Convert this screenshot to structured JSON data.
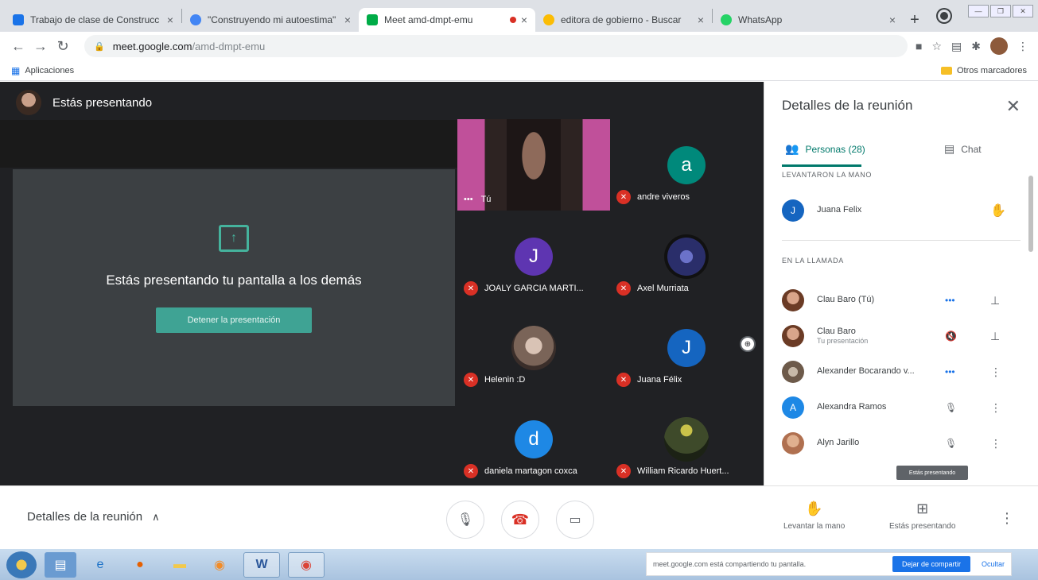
{
  "browser": {
    "tabs": [
      {
        "title": "Trabajo de clase de Construcc",
        "color": "#1a73e8"
      },
      {
        "title": "\"Construyendo mi autoestima\"",
        "color": "#1a73e8"
      },
      {
        "title": "Meet amd-dmpt-emu",
        "color": "#00ac47"
      },
      {
        "title": "editora de gobierno - Buscar",
        "color": "#fbbc04"
      },
      {
        "title": "WhatsApp",
        "color": "#25d366"
      }
    ],
    "url_host": "meet.google.com",
    "url_path": "/amd-dmpt-emu",
    "bookmarks_apps": "Aplicaciones",
    "bookmarks_other": "Otros marcadores"
  },
  "meet": {
    "presenting_header": "Estás presentando",
    "stage_text": "Estás presentando tu pantalla a los demás",
    "stop_button": "Detener la presentación",
    "tiles": [
      {
        "name": "Tú",
        "type": "video"
      },
      {
        "name": "andre viveros",
        "initial": "a",
        "color": "#00897b"
      },
      {
        "name": "JOALY GARCIA MARTI...",
        "initial": "J",
        "color": "#5e35b1"
      },
      {
        "name": "Axel Murriata",
        "type": "photo",
        "color": "#2a2e6a"
      },
      {
        "name": "Helenin :D",
        "type": "photo",
        "color": "#7a6458"
      },
      {
        "name": "Juana Félix",
        "initial": "J",
        "color": "#1565c0"
      },
      {
        "name": "daniela martagon coxca",
        "initial": "d",
        "color": "#1e88e5"
      },
      {
        "name": "William Ricardo Huert...",
        "type": "photo",
        "color": "#3e4a2a"
      }
    ]
  },
  "panel": {
    "title": "Detalles de la reunión",
    "tab_people": "Personas (28)",
    "tab_chat": "Chat",
    "raised_label": "LEVANTARON LA MANO",
    "raised": [
      {
        "name": "Juana Felix",
        "initial": "J",
        "color": "#1565c0"
      }
    ],
    "incall_label": "EN LA LLAMADA",
    "participants": [
      {
        "name": "Clau Baro (Tú)",
        "sub": "",
        "color": "#8d5a3b",
        "initial": ""
      },
      {
        "name": "Clau Baro",
        "sub": "Tu presentación",
        "color": "#8d5a3b",
        "initial": ""
      },
      {
        "name": "Alexander Bocarando v...",
        "sub": "",
        "color": "#6d5a4a",
        "initial": ""
      },
      {
        "name": "Alexandra Ramos",
        "sub": "",
        "color": "#1e88e5",
        "initial": "A"
      },
      {
        "name": "Alyn Jarillo",
        "sub": "",
        "color": "#b07050",
        "initial": ""
      }
    ],
    "tooltip": "Estás presentando"
  },
  "bottom": {
    "meeting_details": "Detalles de la reunión",
    "raise_hand": "Levantar la mano",
    "presenting": "Estás presentando"
  },
  "taskbar": {
    "share_msg": "meet.google.com está compartiendo tu pantalla.",
    "stop_share": "Dejar de compartir",
    "hide": "Ocultar"
  }
}
